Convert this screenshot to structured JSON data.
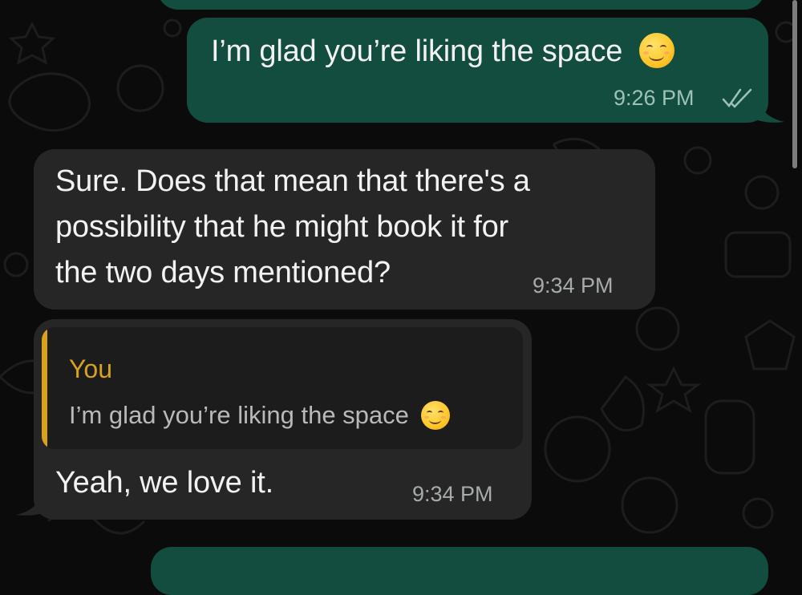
{
  "chat": {
    "messages": [
      {
        "direction": "outgoing",
        "text": "I’m glad you’re liking the space",
        "emoji": "smiling-face-icon",
        "time": "9:26 PM",
        "status": "read-double-check-icon"
      },
      {
        "direction": "incoming",
        "lines": [
          "Sure. Does that mean that there's a",
          "possibility that he might book it for",
          "the two days mentioned?"
        ],
        "time": "9:34 PM"
      },
      {
        "direction": "incoming",
        "reply_to": {
          "sender": "You",
          "text": "I’m glad you’re liking the space",
          "emoji": "smiling-face-icon"
        },
        "text": "Yeah, we love it.",
        "time": "9:34 PM"
      }
    ]
  },
  "colors": {
    "background": "#0b0b0b",
    "outgoing_bubble": "#134d3f",
    "incoming_bubble": "#262626",
    "quote_accent": "#d8a31a"
  }
}
